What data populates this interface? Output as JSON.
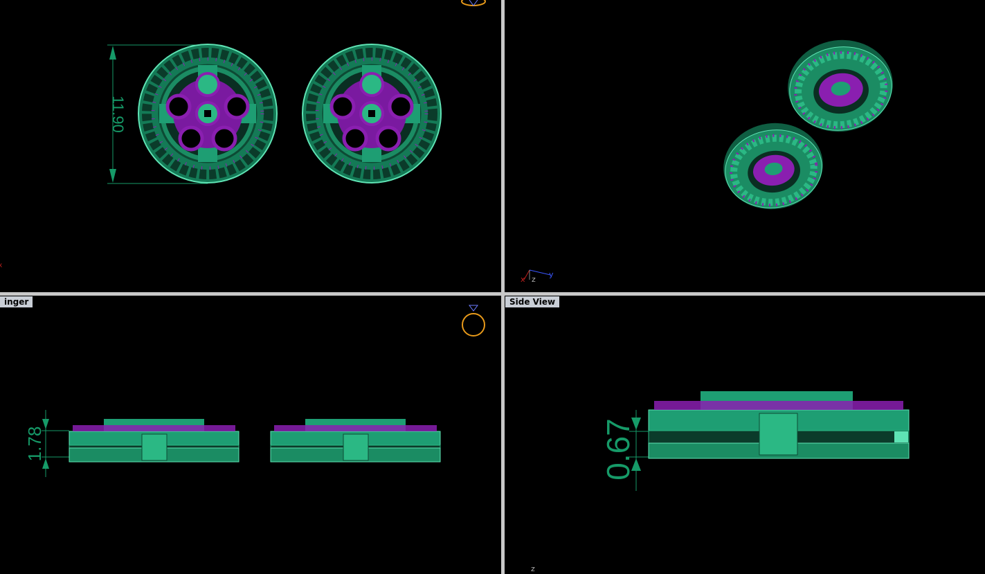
{
  "viewports": {
    "top": {
      "dimension_value": "11.90"
    },
    "perspective": {
      "axis_labels": {
        "x": "x",
        "y": "y",
        "z": "z"
      }
    },
    "front": {
      "title": "inger",
      "dimension_value": "1.78"
    },
    "side": {
      "title": "Side View",
      "dimension_value": "0.67",
      "axis_label": "z"
    }
  },
  "colors": {
    "metal": "#1e9e73",
    "metal_highlight": "#5fe3b4",
    "stone": "#8a1fb0",
    "dimension": "#169a68",
    "ring_icon": "#e89a1a",
    "divider": "#c8c8c8"
  },
  "icons": [
    "ring-navigator-icon",
    "axis-gizmo-icon"
  ]
}
